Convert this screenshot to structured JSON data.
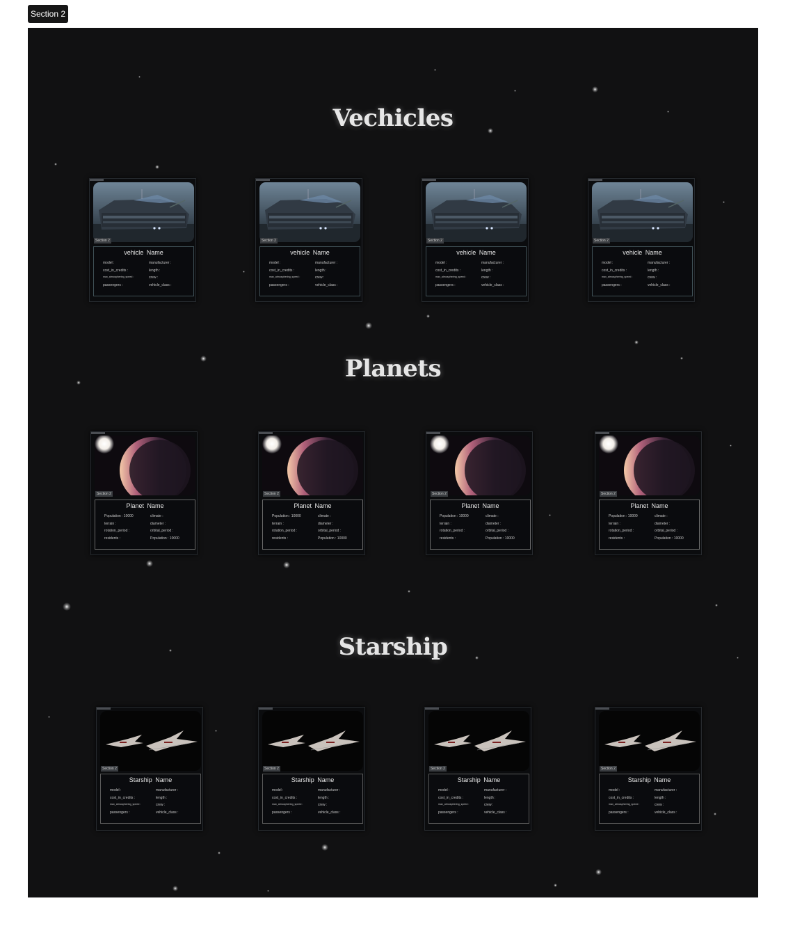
{
  "frame_label": "Section 2",
  "card_tag_label": "Section 2",
  "sections": [
    {
      "title": "Vechicles",
      "card_title": "vehicle  Name",
      "fields_left": [
        "model :",
        "cost_in_credits :",
        "max_atmosphering_speed :",
        "passengers :"
      ],
      "fields_right": [
        "manufacturer :",
        "length :",
        "crew :",
        "vehicle_class :"
      ]
    },
    {
      "title": "Planets",
      "card_title": "Planet Name",
      "fields_left": [
        "Population : 10000",
        "terrain :",
        "rotation_period :",
        "residents :"
      ],
      "fields_right": [
        "climate :",
        "diameter :",
        "orbital_period :",
        "Population : 10000"
      ]
    },
    {
      "title": "Starship",
      "card_title": "Starship  Name",
      "fields_left": [
        "model :",
        "cost_in_credits :",
        "max_atmosphering_speed :",
        "passengers :"
      ],
      "fields_right": [
        "manufacturer :",
        "length :",
        "crew :",
        "vehicle_class :"
      ]
    }
  ],
  "icons": {
    "vehicle_image": "armored-vehicle-image",
    "planet_image": "planet-image",
    "starship_image": "starship-image"
  }
}
